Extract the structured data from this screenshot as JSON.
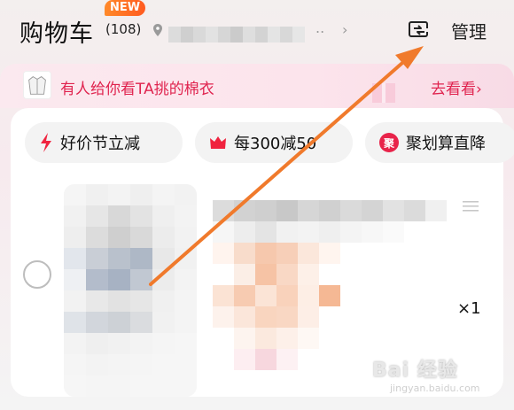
{
  "header": {
    "title": "购物车",
    "count": "(108)",
    "new_badge": "NEW",
    "location_ellipsis": "..",
    "location_arrow": "›",
    "manage_label": "管理"
  },
  "banner": {
    "text": "有人给你看TA挑的棉衣",
    "link": "去看看›"
  },
  "chips": [
    {
      "label": "好价节立减",
      "icon": "lightning-icon"
    },
    {
      "label": "每300减50",
      "icon": "crown-icon"
    },
    {
      "label": "聚划算直降",
      "icon": "juhuasuan-icon",
      "icon_text": "聚"
    }
  ],
  "item": {
    "quantity": "×1"
  },
  "watermark": {
    "main": "Bai 经验",
    "sub": "jingyan.baidu.com"
  },
  "colors": {
    "accent": "#e0244f",
    "arrow": "#f07a2c",
    "chip_bg": "#f3f3f3"
  }
}
